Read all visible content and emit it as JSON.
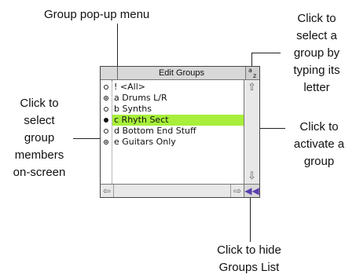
{
  "panel": {
    "title": "Edit Groups",
    "sort_button": {
      "top": "a",
      "bottom": "z"
    },
    "groups": [
      {
        "label": "! <All>",
        "selector": "open",
        "active": false
      },
      {
        "label": "a Drums L/R",
        "selector": "target",
        "active": false
      },
      {
        "label": "b Synths",
        "selector": "open",
        "active": false
      },
      {
        "label": "c Rhyth Sect",
        "selector": "filled",
        "active": true
      },
      {
        "label": "d Bottom End Stuff",
        "selector": "open",
        "active": false
      },
      {
        "label": "e Guitars Only",
        "selector": "target",
        "active": false
      }
    ],
    "icons": {
      "scroll_up": "arrow-up-icon",
      "scroll_down": "arrow-down-icon",
      "scroll_left": "arrow-left-icon",
      "scroll_right": "arrow-right-icon",
      "hide_list": "double-arrow-left-icon"
    },
    "active_color": "#a7ef3a"
  },
  "callouts": {
    "group_popup": "Group pop-up menu",
    "select_by_letter": [
      "Click to",
      "select a",
      "group by",
      "typing its",
      "letter"
    ],
    "select_members": [
      "Click to",
      "select",
      "group",
      "members",
      "on-screen"
    ],
    "activate_group": [
      "Click to",
      "activate a",
      "group"
    ],
    "hide_list": [
      "Click to hide",
      "Groups List"
    ]
  }
}
